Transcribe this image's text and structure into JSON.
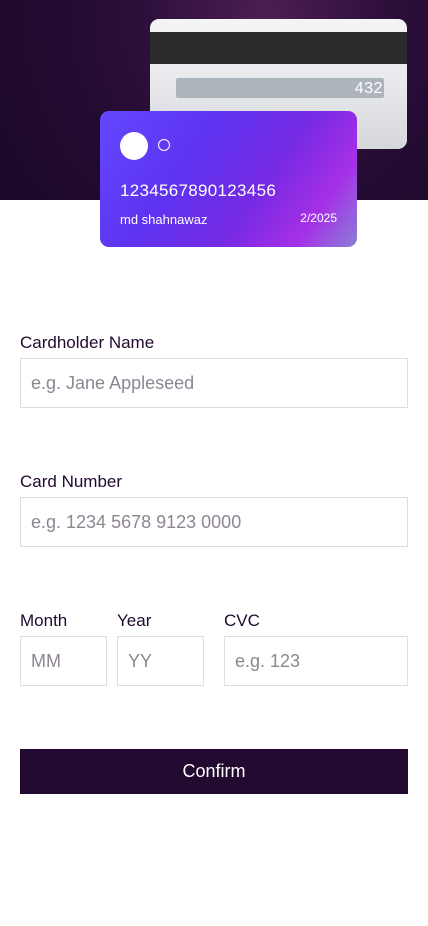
{
  "card_back": {
    "cvc": "432"
  },
  "card_front": {
    "number": "1234567890123456",
    "holder_name": "md shahnawaz",
    "expiry": "2/2025"
  },
  "form": {
    "cardholder": {
      "label": "Cardholder Name",
      "placeholder": "e.g. Jane Appleseed",
      "value": ""
    },
    "card_number": {
      "label": "Card Number",
      "placeholder": "e.g. 1234 5678 9123 0000",
      "value": ""
    },
    "month": {
      "label": "Month",
      "placeholder": "MM",
      "value": ""
    },
    "year": {
      "label": "Year",
      "placeholder": "YY",
      "value": ""
    },
    "cvc": {
      "label": "CVC",
      "placeholder": "e.g. 123",
      "value": ""
    },
    "confirm_label": "Confirm"
  },
  "colors": {
    "hero_background": "#220a30",
    "card_gradient_start": "#6448fe",
    "card_gradient_end": "#a530e6",
    "text_dark": "#21092f",
    "button_background": "#21092f",
    "input_border": "#dedddf",
    "placeholder": "#8e8593"
  }
}
